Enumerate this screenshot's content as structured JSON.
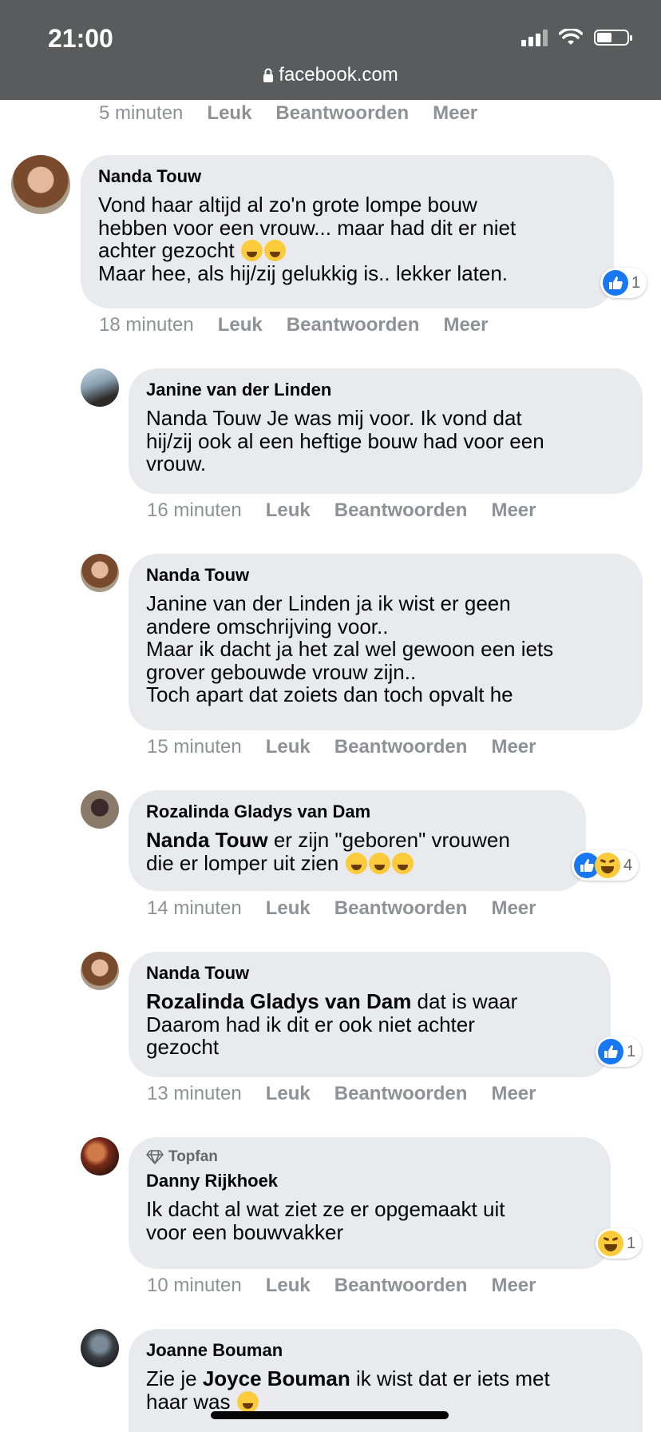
{
  "status_bar": {
    "time": "21:00",
    "url": "facebook.com"
  },
  "actions": {
    "like": "Leuk",
    "reply": "Beantwoorden",
    "more": "Meer"
  },
  "top_timestamp": "5 minuten",
  "comments": [
    {
      "author": "Nanda Touw",
      "lines": [
        "Vond haar altijd al zo'n grote lompe bouw",
        "hebben voor een vrouw... maar had dit er niet",
        "achter gezocht",
        "Maar hee, als hij/zij gelukkig is.. lekker laten."
      ],
      "emoji_line3": [
        "sweat-smile-emoji",
        "thinking-emoji"
      ],
      "time": "18 minuten",
      "reactions": [
        "like"
      ],
      "reaction_count": "1"
    },
    {
      "author": "Janine van der Linden",
      "lines": [
        "Nanda Touw Je was mij voor. Ik vond dat",
        "hij/zij ook al een heftige bouw had voor een",
        "vrouw."
      ],
      "time": "16 minuten"
    },
    {
      "author": "Nanda Touw",
      "lines": [
        "Janine van der Linden ja ik wist er geen",
        "andere omschrijving voor..",
        "Maar ik dacht ja het zal wel gewoon een iets",
        "grover gebouwde vrouw zijn..",
        "Toch apart dat zoiets dan toch opvalt he"
      ],
      "time": "15 minuten"
    },
    {
      "author": "Rozalinda Gladys van Dam",
      "mention": "Nanda Touw",
      "lines": [
        " er zijn \"geboren\" vrouwen",
        "die er lomper uit zien"
      ],
      "emoji_end": [
        "laughing-tears-emoji",
        "laughing-tears-emoji",
        "laughing-tears-emoji"
      ],
      "time": "14 minuten",
      "reactions": [
        "like",
        "haha"
      ],
      "reaction_count": "4"
    },
    {
      "author": "Nanda Touw",
      "mention": "Rozalinda Gladys van Dam",
      "lines": [
        " dat is waar",
        "Daarom had ik dit er ook niet achter",
        "gezocht"
      ],
      "time": "13 minuten",
      "reactions": [
        "like"
      ],
      "reaction_count": "1"
    },
    {
      "badge": "Topfan",
      "author": "Danny Rijkhoek",
      "lines": [
        "Ik dacht al wat ziet ze er opgemaakt uit",
        "voor een bouwvakker"
      ],
      "time": "10 minuten",
      "reactions": [
        "haha"
      ],
      "reaction_count": "1"
    },
    {
      "author": "Joanne Bouman",
      "pre": "Zie je ",
      "mention": "Joyce Bouman",
      "lines": [
        " ik wist dat er iets met",
        "haar was"
      ]
    }
  ],
  "colors": {
    "bubble": "#e9eaed",
    "like_blue": "#1877f2",
    "status_bar": "#5a5b5c",
    "meta_text": "#8e9196"
  }
}
